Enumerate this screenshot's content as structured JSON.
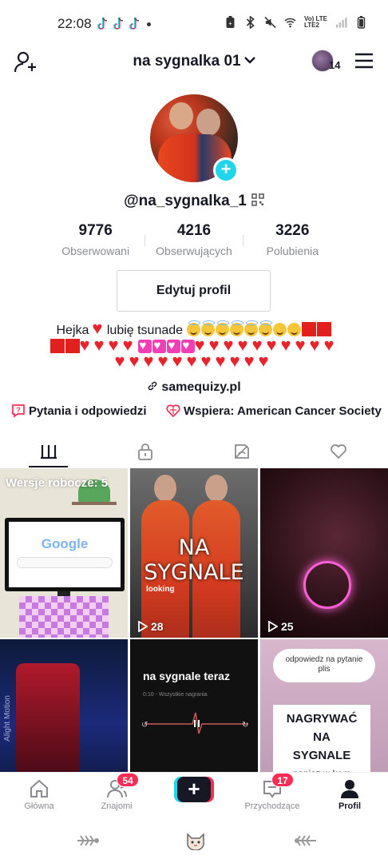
{
  "status_bar": {
    "time": "22:08",
    "network_top": "Vo) LTE",
    "network_bottom": "LTE2",
    "icons": [
      "tiktok-icon",
      "tiktok-icon",
      "tiktok-icon",
      "notification-dot",
      "battery-saver-icon",
      "bluetooth-icon",
      "mute-icon",
      "wifi-icon",
      "signal-icon",
      "battery-icon"
    ]
  },
  "header": {
    "title": "na sygnalka 01",
    "account_badge": "14",
    "icons": [
      "add-friend-icon",
      "chevron-down-icon",
      "menu-icon"
    ]
  },
  "profile": {
    "username": "@na_sygnalka_1",
    "stats": [
      {
        "value": "9776",
        "label": "Obserwowani"
      },
      {
        "value": "4216",
        "label": "Obserwujących"
      },
      {
        "value": "3226",
        "label": "Polubienia"
      }
    ],
    "edit_button": "Edytuj profil",
    "bio_text": "Hejka",
    "bio_text_2": "lubię tsunade",
    "link": "samequizy.pl",
    "qa_label": "Pytania i odpowiedzi",
    "supports_label": "Wspiera: American Cancer Society"
  },
  "tabs": [
    {
      "name": "videos",
      "icon": "grid-icon",
      "active": true
    },
    {
      "name": "private",
      "icon": "lock-icon",
      "active": false
    },
    {
      "name": "reposts",
      "icon": "hidden-eye-icon",
      "active": false
    },
    {
      "name": "liked",
      "icon": "heart-icon",
      "active": false
    }
  ],
  "videos": [
    {
      "label": "Wersje robocze: 5",
      "google_text": "Google"
    },
    {
      "overlay": "NA SYGNALE",
      "caption": "looking",
      "views": "28"
    },
    {
      "views": "25"
    },
    {
      "overlay_vertical": "Alight Motion"
    },
    {
      "overlay": "na sygnale teraz",
      "sub": "0:10 - Wszystkie nagrania"
    },
    {
      "bubble_line1": "odpowiedz na pytanie",
      "bubble_line2": "plis",
      "box_lines": [
        "NAGRYWAĆ",
        "NA",
        "SYGNALE",
        "napisz w kom"
      ]
    }
  ],
  "bottom_nav": [
    {
      "label": "Główna",
      "icon": "home-icon"
    },
    {
      "label": "Znajomi",
      "icon": "friends-icon",
      "badge": "54"
    },
    {
      "label": "",
      "icon": "plus-icon"
    },
    {
      "label": "Przychodzące",
      "icon": "inbox-icon",
      "badge": "17"
    },
    {
      "label": "Profil",
      "icon": "profile-icon",
      "active": true
    }
  ],
  "colors": {
    "accent_pink": "#fe2c55",
    "accent_cyan": "#20d5ec",
    "text": "#161823",
    "muted": "#8a8b91"
  }
}
